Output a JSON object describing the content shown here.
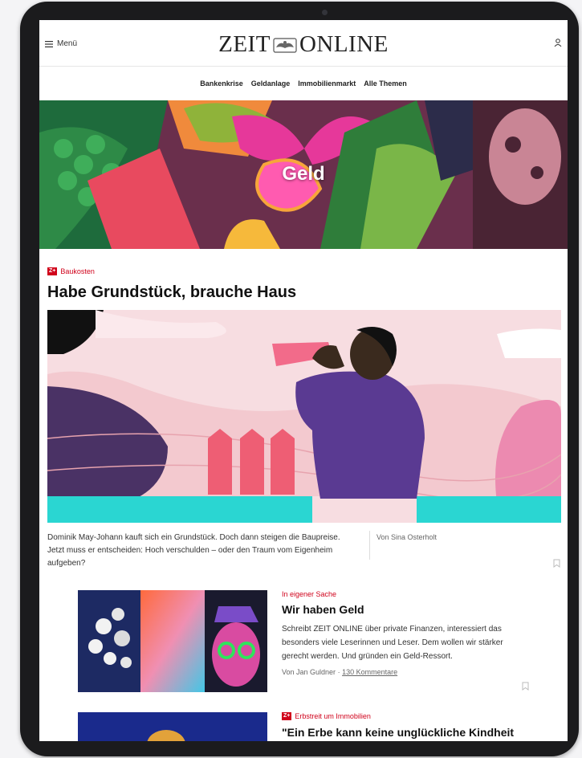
{
  "header": {
    "menu_label": "Menü",
    "logo_text_left": "ZEIT",
    "logo_text_right": "ONLINE"
  },
  "nav": {
    "items": [
      {
        "label": "Bankenkrise"
      },
      {
        "label": "Geldanlage"
      },
      {
        "label": "Immobilienmarkt"
      },
      {
        "label": "Alle Themen"
      }
    ]
  },
  "hero": {
    "title": "Geld"
  },
  "lead": {
    "badge": "Z+",
    "kicker": "Baukosten",
    "title": "Habe Grundstück, brauche Haus",
    "teaser": "Dominik May-Johann kauft sich ein Grundstück. Doch dann steigen die Baupreise. Jetzt muss er entscheiden: Hoch verschulden – oder den Traum vom Eigenheim aufgeben?",
    "author": "Von Sina Osterholt"
  },
  "items": [
    {
      "kicker": "In eigener Sache",
      "title": "Wir haben Geld",
      "text": "Schreibt ZEIT ONLINE über private Finanzen, interessiert das besonders viele Leserinnen und Leser. Dem wollen wir stärker gerecht werden. Und gründen ein Geld-Ressort.",
      "author": "Von Jan Guldner",
      "separator": "·",
      "comments": "130 Kommentare"
    },
    {
      "badge": "Z+",
      "kicker": "Erbstreit um Immobilien",
      "title": "\"Ein Erbe kann keine unglückliche Kindheit"
    }
  ],
  "colors": {
    "accent": "#d0021b",
    "hero_bg": "#5b2b47",
    "lead_bg": "#f3c9cf",
    "figure_shirt": "#5a3a92",
    "teal": "#2ad6d2"
  }
}
